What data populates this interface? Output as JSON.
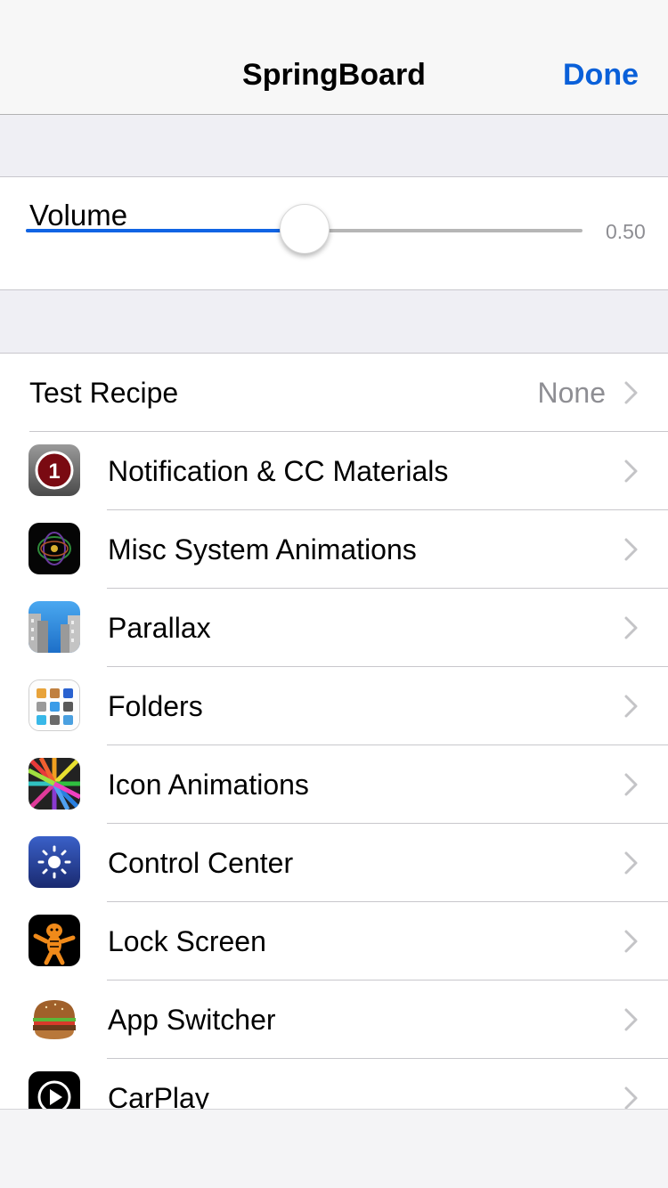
{
  "nav": {
    "title": "SpringBoard",
    "done_label": "Done"
  },
  "volume": {
    "label": "Volume",
    "value_text": "0.50",
    "level": 0.5
  },
  "list": {
    "test_recipe": {
      "label": "Test Recipe",
      "value": "None",
      "icon": "chevron-right-icon"
    },
    "items": [
      {
        "label": "Notification & CC Materials",
        "icon": "notification-badge-icon"
      },
      {
        "label": "Misc System Animations",
        "icon": "misc-animations-icon"
      },
      {
        "label": "Parallax",
        "icon": "parallax-buildings-icon"
      },
      {
        "label": "Folders",
        "icon": "folders-icon"
      },
      {
        "label": "Icon Animations",
        "icon": "color-burst-icon"
      },
      {
        "label": "Control Center",
        "icon": "brightness-sun-icon"
      },
      {
        "label": "Lock Screen",
        "icon": "tigger-icon"
      },
      {
        "label": "App Switcher",
        "icon": "hamburger-icon"
      },
      {
        "label": "CarPlay",
        "icon": "carplay-icon"
      }
    ]
  },
  "colors": {
    "accent": "#0a60d9",
    "slider_fill": "#1164e4",
    "secondary_text": "#8e8e93",
    "background": "#efeff4"
  }
}
